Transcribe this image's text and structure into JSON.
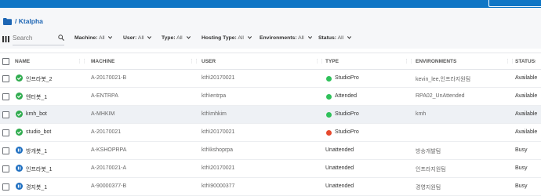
{
  "breadcrumb": {
    "text": "/ Ktalpha"
  },
  "search": {
    "placeholder": "Search"
  },
  "filters": [
    {
      "label": "Machine:",
      "value": "All"
    },
    {
      "label": "User:",
      "value": "All"
    },
    {
      "label": "Type:",
      "value": "All"
    },
    {
      "label": "Hosting Type:",
      "value": "All"
    },
    {
      "label": "Environments:",
      "value": "All"
    },
    {
      "label": "Status:",
      "value": "All"
    }
  ],
  "columns": {
    "name": "NAME",
    "machine": "MACHINE",
    "user": "USER",
    "type": "TYPE",
    "environments": "ENVIRONMENTS",
    "status": "STATUS",
    "sort_arrow": "↑"
  },
  "colors": {
    "ok": "#30ac4f",
    "paused": "#1e6fc1",
    "green_dot": "#2fc15a",
    "red_dot": "#e6492d",
    "topbar": "#0f76c5"
  },
  "rows": [
    {
      "state": "ok",
      "name": "인프라봇_2",
      "machine": "A-20170021-B",
      "user": "kth\\20170021",
      "type": "StudioPro",
      "type_dot": "green",
      "env": "kevin_lee,인프라지원팀",
      "status": "Available"
    },
    {
      "state": "ok",
      "name": "엔터봇_1",
      "machine": "A-ENTRPA",
      "user": "kth\\entrpa",
      "type": "Attended",
      "type_dot": "green",
      "env": "RPA02_UnAttended",
      "status": "Available"
    },
    {
      "state": "ok",
      "name": "kmh_bot",
      "machine": "A-MHKIM",
      "user": "kth\\mhkim",
      "type": "StudioPro",
      "type_dot": "green",
      "env": "kmh",
      "status": "Available"
    },
    {
      "state": "ok",
      "name": "studio_bot",
      "machine": "A-20170021",
      "user": "kth\\20170021",
      "type": "StudioPro",
      "type_dot": "red",
      "env": "",
      "status": "Available"
    },
    {
      "state": "paused",
      "name": "방개봇_1",
      "machine": "A-KSHOPRPA",
      "user": "kth\\kshoprpa",
      "type": "Unattended",
      "type_dot": "",
      "env": "방송개발팀",
      "status": "Busy"
    },
    {
      "state": "paused",
      "name": "인프라봇_1",
      "machine": "A-20170021-A",
      "user": "kth\\20170021",
      "type": "Unattended",
      "type_dot": "",
      "env": "인프라지원팀",
      "status": "Busy"
    },
    {
      "state": "paused",
      "name": "경지봇_1",
      "machine": "A-90000377-B",
      "user": "kth\\90000377",
      "type": "Unattended",
      "type_dot": "",
      "env": "경영지원팀",
      "status": "Busy"
    }
  ]
}
